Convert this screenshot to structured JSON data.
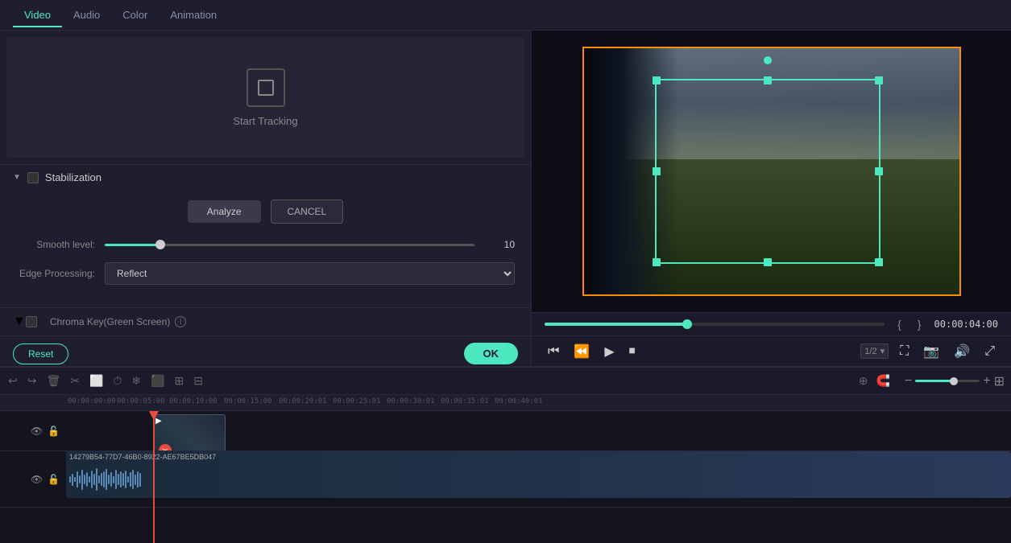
{
  "tabs": {
    "items": [
      {
        "label": "Video",
        "active": true
      },
      {
        "label": "Audio",
        "active": false
      },
      {
        "label": "Color",
        "active": false
      },
      {
        "label": "Animation",
        "active": false
      }
    ]
  },
  "tracking": {
    "label": "Start Tracking"
  },
  "stabilization": {
    "title": "Stabilization",
    "enabled": false,
    "analyze_label": "Analyze",
    "cancel_label": "CANCEL",
    "smooth_level_label": "Smooth level:",
    "smooth_level_value": "10",
    "edge_processing_label": "Edge Processing:",
    "edge_processing_value": "Reflect"
  },
  "chrome_key": {
    "label": "Chroma Key(Green Screen)"
  },
  "actions": {
    "reset_label": "Reset",
    "ok_label": "OK"
  },
  "playback": {
    "time_code": "00:00:04:00",
    "quality": "1/2"
  },
  "timeline": {
    "timestamps": [
      "00:00:00:00",
      "00:00:05:00",
      "00:00:10:00",
      "00:00:15:00",
      "00:00:20:01",
      "00:00:25:01",
      "00:00:30:01",
      "00:00:35:01",
      "00:00:40:01"
    ],
    "clip_label": "14279B54-77D7-46B0-8922-AE67BE5DB047"
  }
}
